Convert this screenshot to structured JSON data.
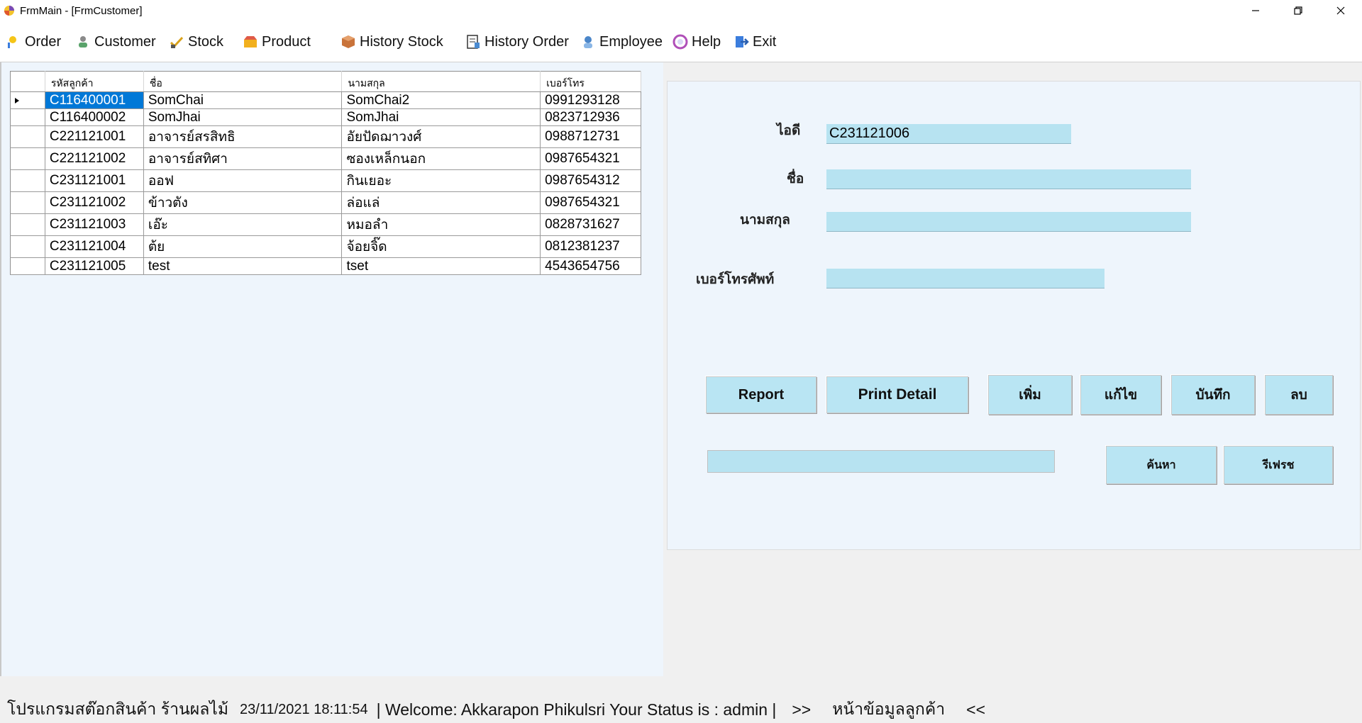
{
  "window": {
    "title": "FrmMain - [FrmCustomer]"
  },
  "menu": [
    {
      "label": "Order",
      "icon": "order-icon"
    },
    {
      "label": "Customer",
      "icon": "customer-icon"
    },
    {
      "label": "Stock",
      "icon": "stock-icon"
    },
    {
      "label": "Product",
      "icon": "product-icon"
    },
    {
      "label": "History Stock",
      "icon": "history-stock-icon"
    },
    {
      "label": "History Order",
      "icon": "history-order-icon"
    },
    {
      "label": "Employee",
      "icon": "employee-icon"
    },
    {
      "label": "Help",
      "icon": "help-icon"
    },
    {
      "label": "Exit",
      "icon": "exit-icon"
    }
  ],
  "grid": {
    "columns": [
      "รหัสลูกค้า",
      "ชื่อ",
      "นามสกุล",
      "เบอร์โทร"
    ],
    "selected_row": 0,
    "rows": [
      [
        "C116400001",
        "SomChai",
        "SomChai2",
        "0991293128"
      ],
      [
        "C116400002",
        "SomJhai",
        "SomJhai",
        "0823712936"
      ],
      [
        "C221121001",
        "อาจารย์สรสิทธิ",
        "อัยปัดฌาวงศ์",
        "0988712731"
      ],
      [
        "C221121002",
        "อาจารย์สทิศา",
        "ซองเหล็กนอก",
        "0987654321"
      ],
      [
        "C231121001",
        "ออฟ",
        "กินเยอะ",
        "0987654312"
      ],
      [
        "C231121002",
        "ข้าวตัง",
        "ล่อแล่",
        "0987654321"
      ],
      [
        "C231121003",
        "เอ๊ะ",
        "หมอลํา",
        "0828731627"
      ],
      [
        "C231121004",
        "ต้ย",
        "จ้อยจิ๊ด",
        "0812381237"
      ],
      [
        "C231121005",
        "test",
        "tset",
        "4543654756"
      ]
    ]
  },
  "form": {
    "id_label": "ไอดี",
    "id_value": "C231121006",
    "name_label": "ชื่อ",
    "name_value": "",
    "surname_label": "นามสกุล",
    "surname_value": "",
    "phone_label": "เบอร์โทรศัพท์",
    "phone_value": "",
    "search_value": ""
  },
  "buttons": {
    "report": "Report",
    "print_detail": "Print Detail",
    "add": "เพิ่ม",
    "edit": "แก้ไข",
    "save": "บันทึก",
    "delete": "ลบ",
    "search": "ค้นหา",
    "refresh": "รีเฟรช"
  },
  "status": {
    "app_name": "โปรแกรมสต๊อกสินค้า ร้านผลไม้",
    "datetime": "23/11/2021 18:11:54",
    "welcome": "| Welcome: Akkarapon Phikulsri Your Status is : admin |",
    "nav_right": ">>",
    "page_name": "หน้าข้อมูลลูกค้า",
    "nav_left": "<<"
  },
  "colors": {
    "field_bg": "#b7e3f1",
    "button_bg": "#b9e5f3",
    "pane_bg": "#eef5fc",
    "selection": "#0078d7"
  }
}
